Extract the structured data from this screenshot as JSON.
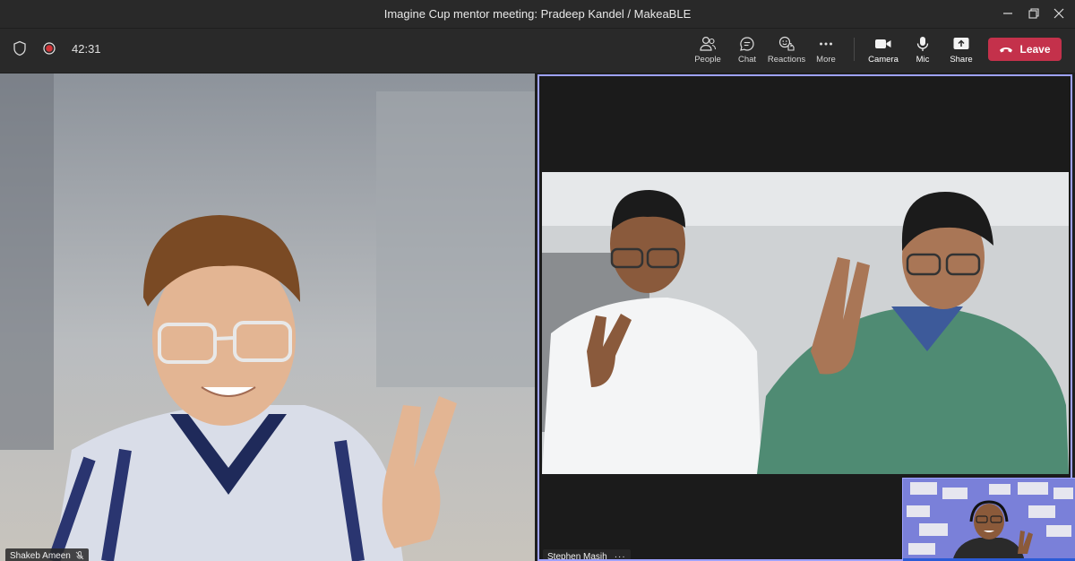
{
  "window": {
    "title": "Imagine Cup mentor meeting: Pradeep Kandel / MakeaBLE"
  },
  "toolbar": {
    "timer": "42:31",
    "buttons": [
      {
        "label": "People",
        "icon": "people-icon"
      },
      {
        "label": "Chat",
        "icon": "chat-icon"
      },
      {
        "label": "Reactions",
        "icon": "reactions-icon"
      },
      {
        "label": "More",
        "icon": "more-icon"
      },
      {
        "label": "Camera",
        "icon": "camera-icon"
      },
      {
        "label": "Mic",
        "icon": "mic-icon"
      },
      {
        "label": "Share",
        "icon": "share-icon"
      }
    ],
    "leave_label": "Leave"
  },
  "participants": {
    "left_name": "Shakeb Ameen",
    "right_name": "Stephen Masih",
    "right_more": "···"
  },
  "colors": {
    "bar": "#292929",
    "leave": "#c4314b",
    "active_speaker_border": "#9ea2ff"
  }
}
